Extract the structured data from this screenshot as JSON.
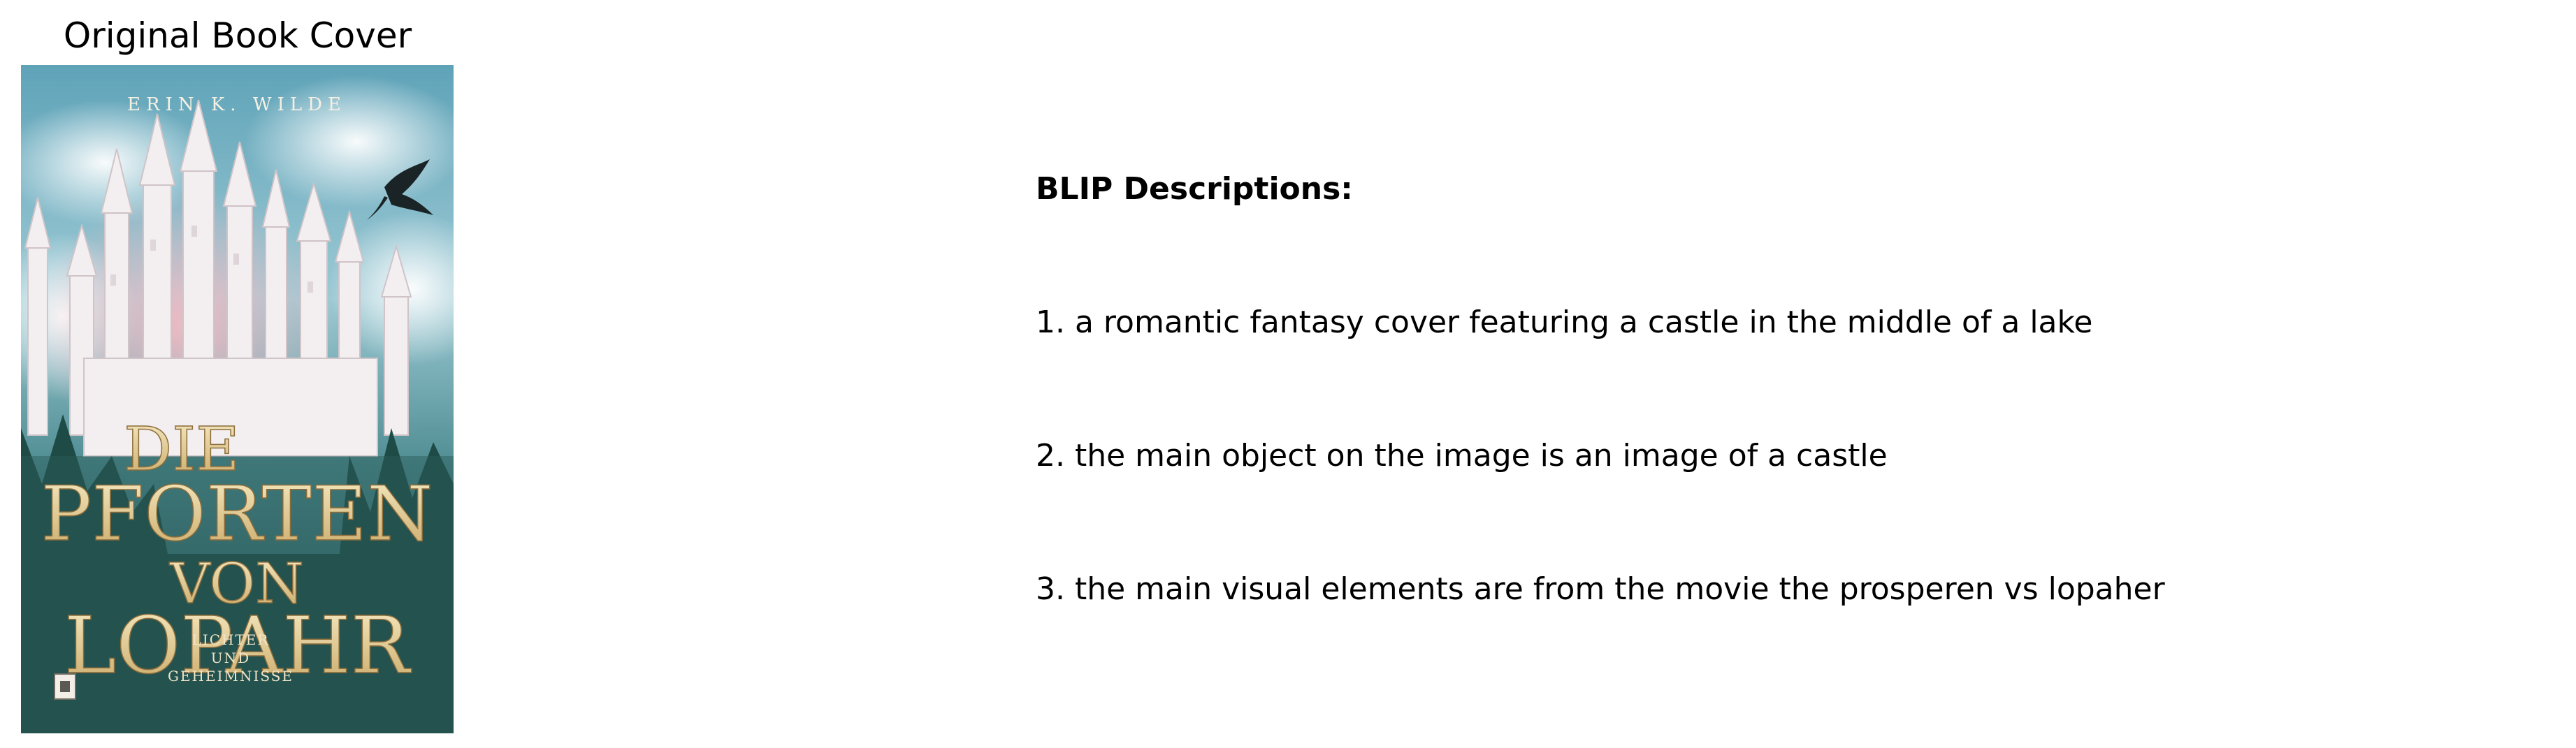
{
  "panel": {
    "title": "Original Book Cover"
  },
  "cover": {
    "author": "ERIN K. WILDE",
    "title_line1": "DIE",
    "title_line2": "PFORTEN",
    "title_line3": "VON",
    "title_line4": "LOPAHR",
    "subtitle_line1": "LICHTER",
    "subtitle_line2": "UND",
    "subtitle_line3": "GEHEIMNISSE",
    "colors": {
      "sky": "#7fb9c9",
      "fog": "#e9eef0",
      "castle": "#f4eef0",
      "glow": "#f1a6b2",
      "forest": "#1f4b47",
      "gold": "#e8d7a4"
    }
  },
  "descriptions": {
    "heading": "BLIP Descriptions:",
    "items": [
      "1. a romantic fantasy cover featuring a castle in the middle of a lake",
      "2. the main object on the image is an image of a castle",
      "3. the main visual elements are from the movie the prosperen vs lopaher"
    ]
  }
}
